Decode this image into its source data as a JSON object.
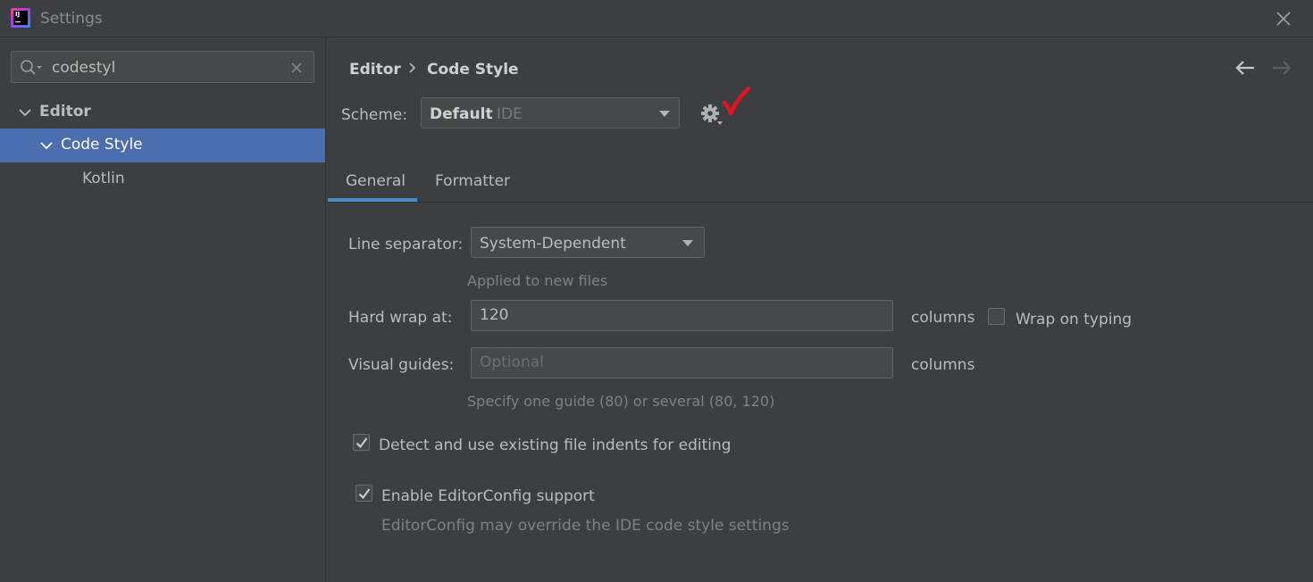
{
  "window": {
    "title": "Settings"
  },
  "search": {
    "value": "codestyl"
  },
  "tree": {
    "items": [
      {
        "label": "Editor"
      },
      {
        "label": "Code Style"
      },
      {
        "label": "Kotlin"
      }
    ]
  },
  "breadcrumb": {
    "parent": "Editor",
    "current": "Code Style"
  },
  "scheme": {
    "label": "Scheme:",
    "name": "Default",
    "type": "IDE"
  },
  "tabs": [
    {
      "label": "General"
    },
    {
      "label": "Formatter"
    }
  ],
  "general": {
    "line_separator": {
      "label": "Line separator:",
      "value": "System-Dependent",
      "hint": "Applied to new files"
    },
    "hard_wrap": {
      "label": "Hard wrap at:",
      "value": "120",
      "units": "columns",
      "wrap_on_typing_label": "Wrap on typing",
      "wrap_on_typing_checked": false
    },
    "visual_guides": {
      "label": "Visual guides:",
      "placeholder": "Optional",
      "units": "columns",
      "hint": "Specify one guide (80) or several (80, 120)"
    },
    "detect_indents": {
      "label": "Detect and use existing file indents for editing",
      "checked": true
    },
    "editorconfig": {
      "label": "Enable EditorConfig support",
      "checked": true,
      "hint": "EditorConfig may override the IDE code style settings"
    }
  },
  "colors": {
    "background": "#3c3f41",
    "selection": "#4b6eaf",
    "tab_accent": "#4a88c7",
    "annotation": "#e8101f"
  },
  "icons": {
    "app": "intellij-logo-icon",
    "close": "close-icon",
    "search": "search-icon",
    "clear": "clear-icon",
    "back": "arrow-left-icon",
    "forward": "arrow-right-icon",
    "gear": "gear-icon",
    "annotation": "red-checkmark-icon"
  }
}
